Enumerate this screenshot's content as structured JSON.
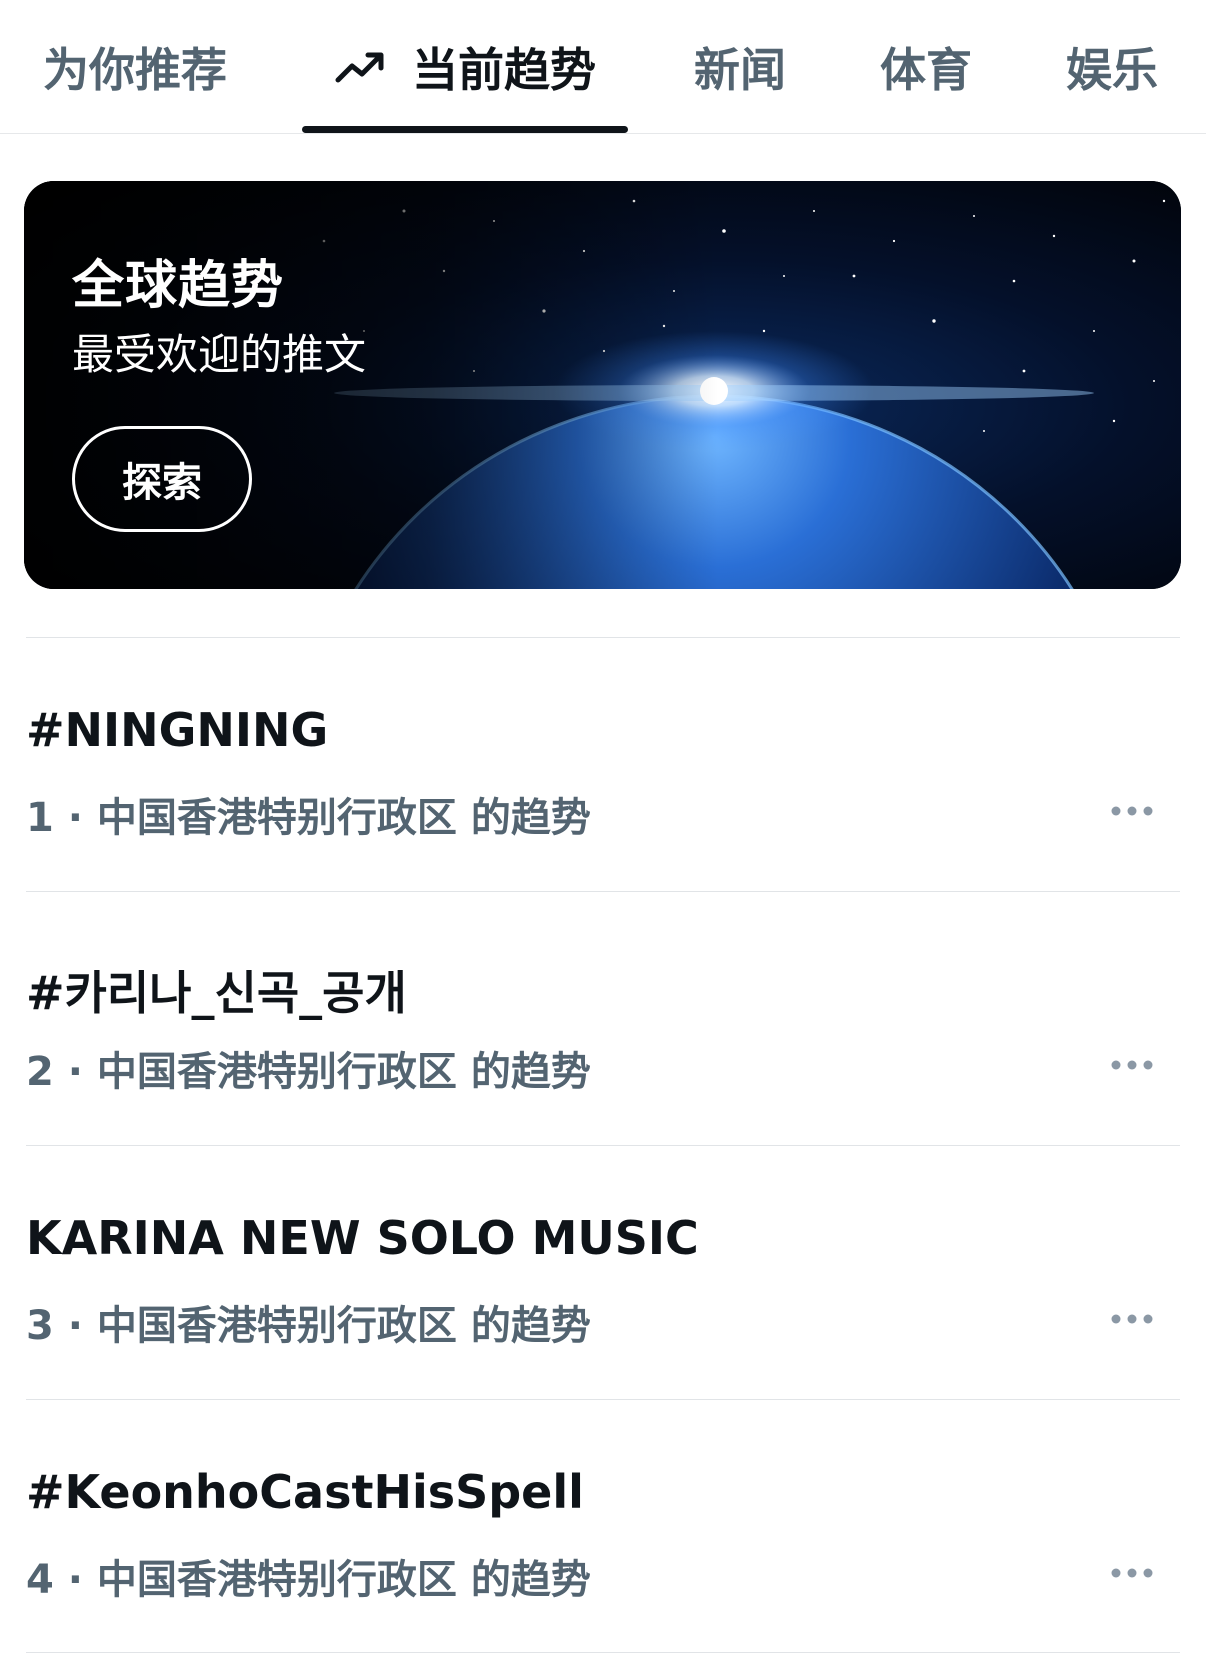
{
  "tabs": [
    {
      "label": "为你推荐",
      "active": false
    },
    {
      "label": "当前趋势",
      "active": true,
      "icon": "trending-arrow-icon"
    },
    {
      "label": "新闻",
      "active": false
    },
    {
      "label": "体育",
      "active": false
    },
    {
      "label": "娱乐",
      "active": false
    }
  ],
  "banner": {
    "title": "全球趋势",
    "subtitle": "最受欢迎的推文",
    "explore_label": "探索"
  },
  "trends": [
    {
      "title": "#NINGNING",
      "rank": "1",
      "location_text": "中国香港特别行政区 的趋势"
    },
    {
      "title": "#카리나_신곡_공개",
      "rank": "2",
      "location_text": "中国香港特别行政区 的趋势"
    },
    {
      "title": "KARINA NEW SOLO MUSIC",
      "rank": "3",
      "location_text": "中国香港特别行政区 的趋势"
    },
    {
      "title": "#KeonhoCastHisSpell",
      "rank": "4",
      "location_text": "中国香港特别行政区 的趋势"
    }
  ],
  "colors": {
    "text_primary": "#0f1419",
    "text_secondary": "#536471",
    "divider": "#e1e4e7",
    "more_dots": "#8b98a5"
  }
}
